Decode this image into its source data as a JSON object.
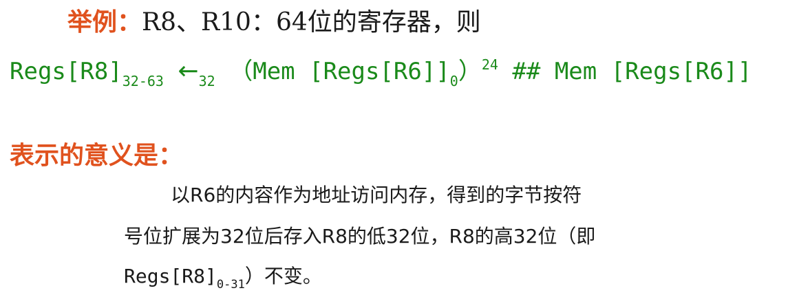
{
  "example": {
    "label": "举例：",
    "text": "R8、R10：64位的寄存器，则"
  },
  "formula": {
    "lhs": "Regs[R8]",
    "lhs_sub": "32-63",
    "arrow": "←",
    "arrow_sub": "32",
    "part1": "（Mem [Regs[R6]]",
    "part1_sub": "0",
    "part1_close": "）",
    "sup": "24",
    "part2": " ## Mem [Regs[R6]]"
  },
  "meaning": {
    "heading": "表示的意义是：",
    "line1": "以R6的内容作为地址访问内存，得到的字节按符",
    "line2": "号位扩展为32位后存入R8的低32位，R8的高32位（即",
    "line3_mono": "Regs[R8]",
    "line3_sub": "0-31",
    "line3_rest": "）不变。"
  },
  "colors": {
    "accent_orange": "#e0521e",
    "formula_green": "#1a8a1a",
    "text": "#1a1a1a"
  }
}
